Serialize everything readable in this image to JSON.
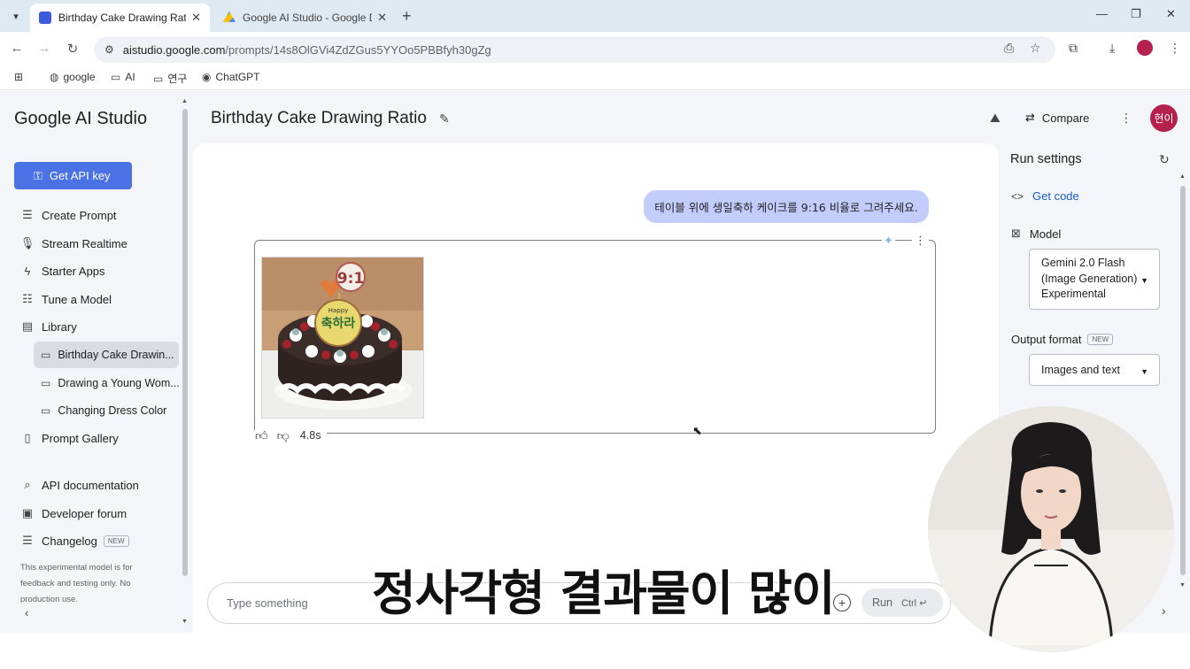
{
  "browser": {
    "tabs": [
      {
        "title": "Birthday Cake Drawing Ratio |",
        "active": true
      },
      {
        "title": "Google AI Studio - Google Dri",
        "active": false
      }
    ],
    "url_host": "aistudio.google.com",
    "url_path": "/prompts/14s8OlGVi4ZdZGus5YYOo5PBBfyh30gZg",
    "bookmarks": [
      "google",
      "AI",
      "연구",
      "ChatGPT"
    ]
  },
  "sidebar": {
    "brand": "Google AI Studio",
    "api_button": "Get API key",
    "items": [
      {
        "label": "Create Prompt",
        "icon": "create-prompt-icon"
      },
      {
        "label": "Stream Realtime",
        "icon": "microphone-icon"
      },
      {
        "label": "Starter Apps",
        "icon": "bolt-icon"
      },
      {
        "label": "Tune a Model",
        "icon": "tune-icon"
      },
      {
        "label": "Library",
        "icon": "library-icon"
      }
    ],
    "library_items": [
      "Birthday Cake Drawin...",
      "Drawing a Young Wom...",
      "Changing Dress Color"
    ],
    "gallery": "Prompt Gallery",
    "links": [
      {
        "label": "API documentation"
      },
      {
        "label": "Developer forum"
      },
      {
        "label": "Changelog",
        "badge": "NEW"
      }
    ],
    "disclaimer": "This experimental model is for feedback and testing only. No production use."
  },
  "header": {
    "title": "Birthday Cake Drawing Ratio",
    "compare": "Compare",
    "avatar_text": "현이"
  },
  "chat": {
    "user_message": "테이블 위에 생일축하 케이크를 9:16 비율로 그려주세요.",
    "response_time": "4.8s",
    "cake_topper": "9:1",
    "cake_plaque_top": "Happy",
    "cake_plaque_main": "축하라"
  },
  "prompt": {
    "placeholder": "Type something",
    "run_label": "Run",
    "run_shortcut": "Ctrl ↵"
  },
  "caption": "정사각형 결과물이 많이",
  "run_settings": {
    "title": "Run settings",
    "get_code": "Get code",
    "model_label": "Model",
    "model_value": "Gemini 2.0 Flash (Image Generation) Experimental",
    "output_label": "Output format",
    "output_badge": "NEW",
    "output_value": "Images and text"
  },
  "colors": {
    "accent": "#4a72e5",
    "user_bubble": "#c3cdfb",
    "avatar": "#b5214d",
    "link": "#1a5fd1"
  }
}
